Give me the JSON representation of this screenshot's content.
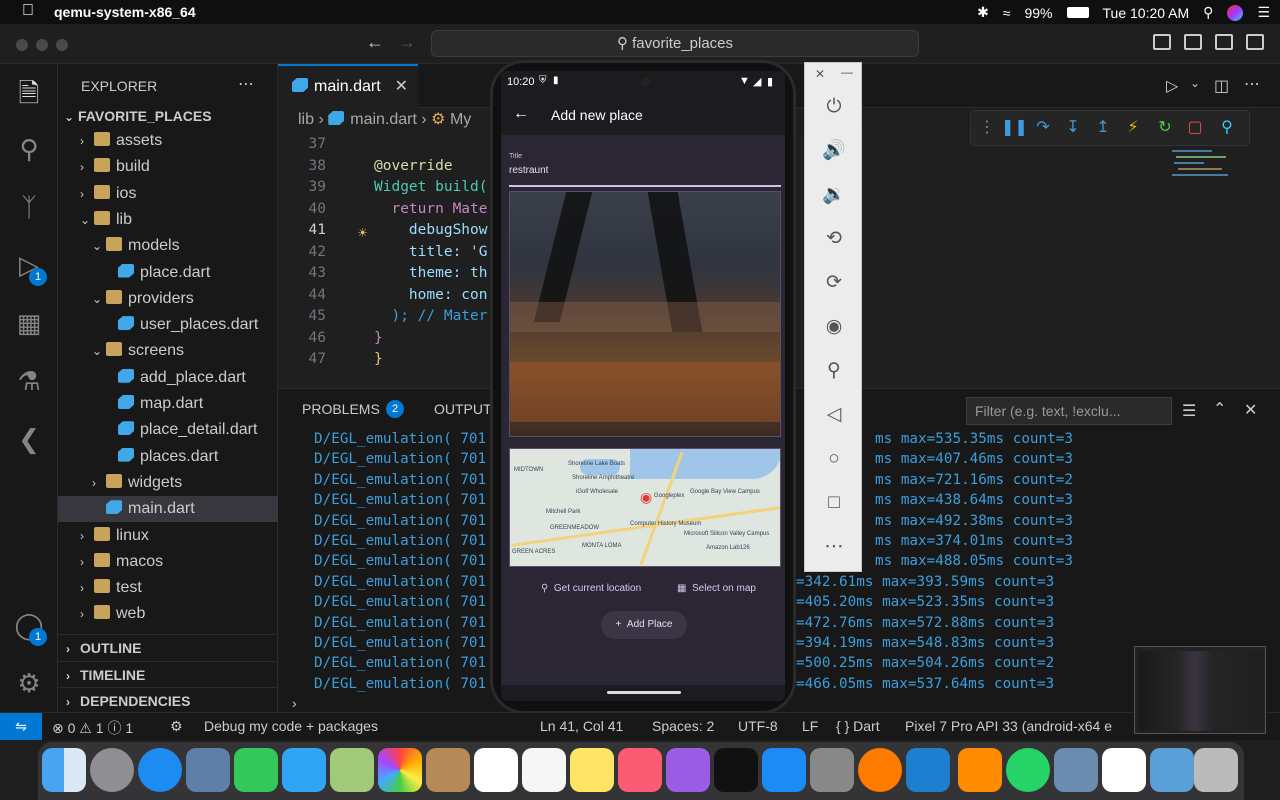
{
  "menubar": {
    "app_name": "qemu-system-x86_64",
    "battery": "99%",
    "clock": "Tue 10:20 AM"
  },
  "window": {
    "search_text": "favorite_places"
  },
  "activity": {
    "debug_badge": "1",
    "account_badge": "1"
  },
  "explorer": {
    "header": "EXPLORER",
    "root": "FAVORITE_PLACES",
    "items": [
      {
        "label": "assets",
        "indent": 1,
        "type": "folder",
        "expanded": false
      },
      {
        "label": "build",
        "indent": 1,
        "type": "folder",
        "expanded": false
      },
      {
        "label": "ios",
        "indent": 1,
        "type": "folder",
        "expanded": false
      },
      {
        "label": "lib",
        "indent": 1,
        "type": "folder",
        "expanded": true
      },
      {
        "label": "models",
        "indent": 2,
        "type": "folder",
        "expanded": true
      },
      {
        "label": "place.dart",
        "indent": 3,
        "type": "dart"
      },
      {
        "label": "providers",
        "indent": 2,
        "type": "folder",
        "expanded": true
      },
      {
        "label": "user_places.dart",
        "indent": 3,
        "type": "dart"
      },
      {
        "label": "screens",
        "indent": 2,
        "type": "folder",
        "expanded": true
      },
      {
        "label": "add_place.dart",
        "indent": 3,
        "type": "dart"
      },
      {
        "label": "map.dart",
        "indent": 3,
        "type": "dart"
      },
      {
        "label": "place_detail.dart",
        "indent": 3,
        "type": "dart"
      },
      {
        "label": "places.dart",
        "indent": 3,
        "type": "dart"
      },
      {
        "label": "widgets",
        "indent": 2,
        "type": "folder",
        "expanded": false
      },
      {
        "label": "main.dart",
        "indent": 2,
        "type": "dart",
        "selected": true
      },
      {
        "label": "linux",
        "indent": 1,
        "type": "folder",
        "expanded": false
      },
      {
        "label": "macos",
        "indent": 1,
        "type": "folder",
        "expanded": false
      },
      {
        "label": "test",
        "indent": 1,
        "type": "folder",
        "expanded": false
      },
      {
        "label": "web",
        "indent": 1,
        "type": "folder",
        "expanded": false
      }
    ],
    "sections": [
      "OUTLINE",
      "TIMELINE",
      "DEPENDENCIES"
    ]
  },
  "editor": {
    "tab": "main.dart",
    "breadcrumb": [
      "lib",
      "main.dart",
      "My"
    ],
    "lines": [
      {
        "n": "37",
        "text": ""
      },
      {
        "n": "38",
        "text": "@override"
      },
      {
        "n": "39",
        "text": "Widget build("
      },
      {
        "n": "40",
        "text": "  return Mate"
      },
      {
        "n": "41",
        "text": "    debugShow"
      },
      {
        "n": "42",
        "text": "    title: 'G"
      },
      {
        "n": "43",
        "text": "    theme: th"
      },
      {
        "n": "44",
        "text": "    home: con"
      },
      {
        "n": "45",
        "text": "  ); // Mater"
      },
      {
        "n": "46",
        "text": "}"
      },
      {
        "n": "47",
        "text": "}"
      }
    ]
  },
  "panel": {
    "tabs": [
      "PROBLEMS",
      "OUTPUT"
    ],
    "problems_count": "2",
    "filter_placeholder": "Filter (e.g. text, !exclu...",
    "log_prefix": "D/EGL_emulation( 701",
    "log_suffixes": [
      "ms max=535.35ms count=3",
      "ms max=407.46ms count=3",
      "ms max=721.16ms count=2",
      "ms max=438.64ms count=3",
      "ms max=492.38ms count=3",
      "ms max=374.01ms count=3",
      "ms max=488.05ms count=3",
      "=342.61ms max=393.59ms count=3",
      "=405.20ms max=523.35ms count=3",
      "=472.76ms max=572.88ms count=3",
      "=394.19ms max=548.83ms count=3",
      "=500.25ms max=504.26ms count=2",
      "=466.05ms max=537.64ms count=3"
    ]
  },
  "status": {
    "errors": "0",
    "warnings": "1",
    "info": "1",
    "debug": "Debug my code + packages",
    "position": "Ln 41, Col 41",
    "spaces": "Spaces: 2",
    "encoding": "UTF-8",
    "eol": "LF",
    "language": "{ } Dart",
    "device": "Pixel 7 Pro API 33 (android-x64 e"
  },
  "phone": {
    "time": "10:20",
    "title": "Add new place",
    "field_label": "Title",
    "field_value": "restraunt",
    "location_button": "Get current location",
    "map_button": "Select on map",
    "add_button": "Add Place",
    "map_labels": [
      "MIDTOWN",
      "Shoreline Lake Boats",
      "Shoreline Amphitheatre",
      "iGolf Wholesale",
      "Googleplex",
      "Google Bay View Campus",
      "Mitchell Park",
      "GREENMEADOW",
      "Computer History Museum",
      "Microsoft Silicon Valley Campus",
      "MONTA LOMA",
      "GREEN ACRES",
      "Amazon Lab126"
    ]
  },
  "colors": {
    "accent": "#0078d4",
    "log": "#3c9ddb",
    "phone_bg": "#2b2634"
  }
}
